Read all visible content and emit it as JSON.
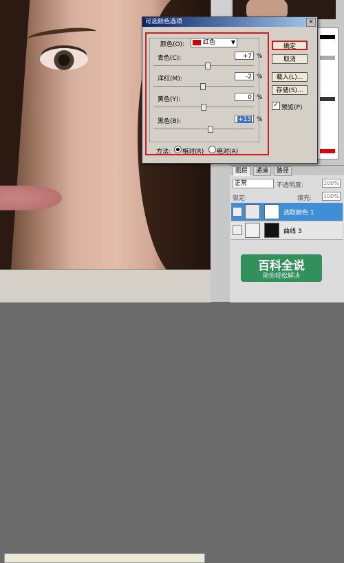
{
  "dialog": {
    "title": "可选颜色选项",
    "close_glyph": "×",
    "colors_label": "颜色(O):",
    "colors_value": "红色",
    "colors_swatch": "#d40000",
    "sliders": [
      {
        "label": "青色(C):",
        "value": "+7",
        "unit": "%",
        "level": 0.54
      },
      {
        "label": "洋红(M):",
        "value": "-2",
        "unit": "%",
        "level": 0.49
      },
      {
        "label": "黄色(Y):",
        "value": "0",
        "unit": "%",
        "level": 0.5
      },
      {
        "label": "黑色(B):",
        "value": "+13",
        "unit": "%",
        "level": 0.57
      }
    ],
    "method_label": "方法:",
    "method_relative": "相对(R)",
    "method_absolute": "绝对(A)",
    "buttons": {
      "ok": "确定",
      "cancel": "取消",
      "load": "载入(L)...",
      "save": "存储(S)..."
    },
    "preview_label": "预览(P)",
    "preview_checked": "✓"
  },
  "layers_panel": {
    "tabs": [
      "图层",
      "通道",
      "路径"
    ],
    "blend_mode": "正常",
    "opacity_label": "不透明度:",
    "opacity_value": "100%",
    "lock_label": "锁定:",
    "fill_label": "填充:",
    "fill_value": "100%",
    "layers": [
      {
        "name": "选取颜色 1",
        "selected": true
      },
      {
        "name": "曲线 3",
        "selected": false
      }
    ]
  },
  "watermark": {
    "title": "百科全说",
    "subtitle": "助你轻松解决"
  },
  "colors": {
    "accent_red": "#d31820",
    "selection_blue": "#3f8fd8",
    "title_blue": "#0a246a"
  }
}
